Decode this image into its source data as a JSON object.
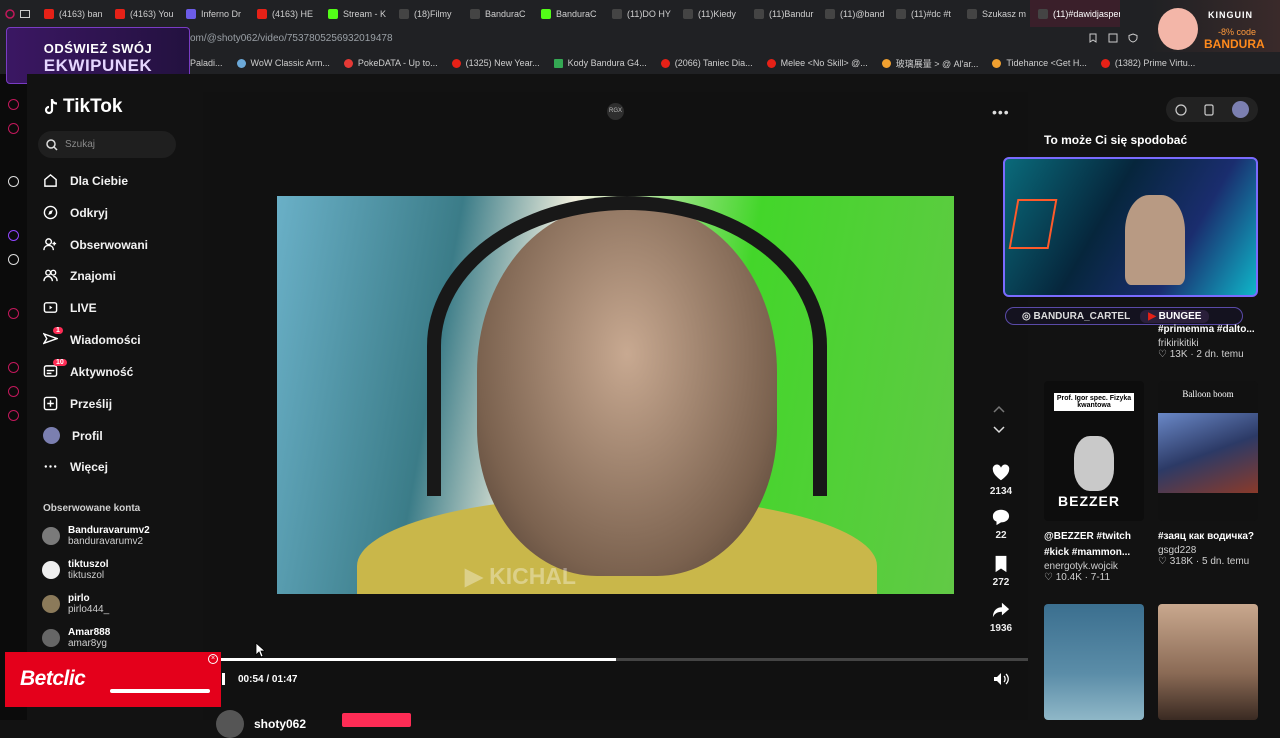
{
  "browser": {
    "tabs": [
      "(4163) ban",
      "(4163) You",
      "Inferno Dr",
      "(4163) HE",
      "Stream - K",
      "(18)Filmy",
      "BanduraC",
      "BanduraC",
      "(11)DO HY",
      "(11)Kiedy",
      "(11)Bandur",
      "(11)@band",
      "(11)#dc #t",
      "Szukasz m",
      "(11)#dawidjasper"
    ],
    "url": "om/@shoty062/video/7537805256932019478",
    "bookmarks": [
      "Paladi...",
      "WoW Classic Arm...",
      "PokeDATA - Up to...",
      "(1325) New Year...",
      "Kody Bandura G4...",
      "(2066) Taniec Dia...",
      "Melee <No Skill> @...",
      "玻璃展量 > @ Al'ar...",
      "Tidehance <Get H...",
      "(1382) Prime Virtu..."
    ]
  },
  "promo": {
    "line1": "ODŚWIEŻ SWÓJ",
    "line2": "EKWIPUNEK"
  },
  "kinguin": {
    "brand": "KINGUIN",
    "discount": "-8% code",
    "code": "BANDURA"
  },
  "sidebar": {
    "logo": "TikTok",
    "search_placeholder": "Szukaj",
    "nav": [
      {
        "label": "Dla Ciebie"
      },
      {
        "label": "Odkryj"
      },
      {
        "label": "Obserwowani"
      },
      {
        "label": "Znajomi"
      },
      {
        "label": "LIVE"
      },
      {
        "label": "Wiadomości",
        "badge": "1"
      },
      {
        "label": "Aktywność",
        "badge": "10"
      },
      {
        "label": "Prześlij"
      },
      {
        "label": "Profil"
      },
      {
        "label": "Więcej"
      }
    ],
    "following_title": "Obserwowane konta",
    "accounts": [
      {
        "name": "Banduravarumv2",
        "handle": "banduravarumv2"
      },
      {
        "name": "tiktuszol",
        "handle": "tiktuszol"
      },
      {
        "name": "pirlo",
        "handle": "pirlo444_"
      },
      {
        "name": "Amar888",
        "handle": "amar8yg"
      }
    ]
  },
  "ad": {
    "brand": "Betclic"
  },
  "player": {
    "channel_badge": "RGX",
    "watermark": "KICHAL",
    "likes": "2134",
    "comments": "22",
    "saves": "272",
    "shares": "1936",
    "progress": 0.49,
    "time": "00:54 / 01:47",
    "author": "shoty062"
  },
  "recommended": {
    "title": "To może Ci się spodobać",
    "social": {
      "instagram": "BANDURA_CARTEL",
      "youtube": "BUNGEE"
    },
    "cards": [
      {
        "title": "#primemma #dalto...",
        "user": "frikirikitiki",
        "stats": "13K · 2 dn. temu"
      },
      {
        "thumb_text1": "Prof. Igor spec. Fizyka kwantowa",
        "thumb_text2": "BEZZER",
        "title": "@BEZZER #twitch",
        "title2": "#kick #mammon...",
        "user": "energotyk.wojcik",
        "stats": "10.4K · 7-11"
      },
      {
        "thumb_text1": "Balloon boom",
        "title": "#заяц как водичка?",
        "user": "gsgd228",
        "stats": "318K · 5 dn. temu"
      }
    ]
  },
  "colors": {
    "accent": "#fe2c55",
    "background": "#121212",
    "ad_red": "#e4001b"
  }
}
